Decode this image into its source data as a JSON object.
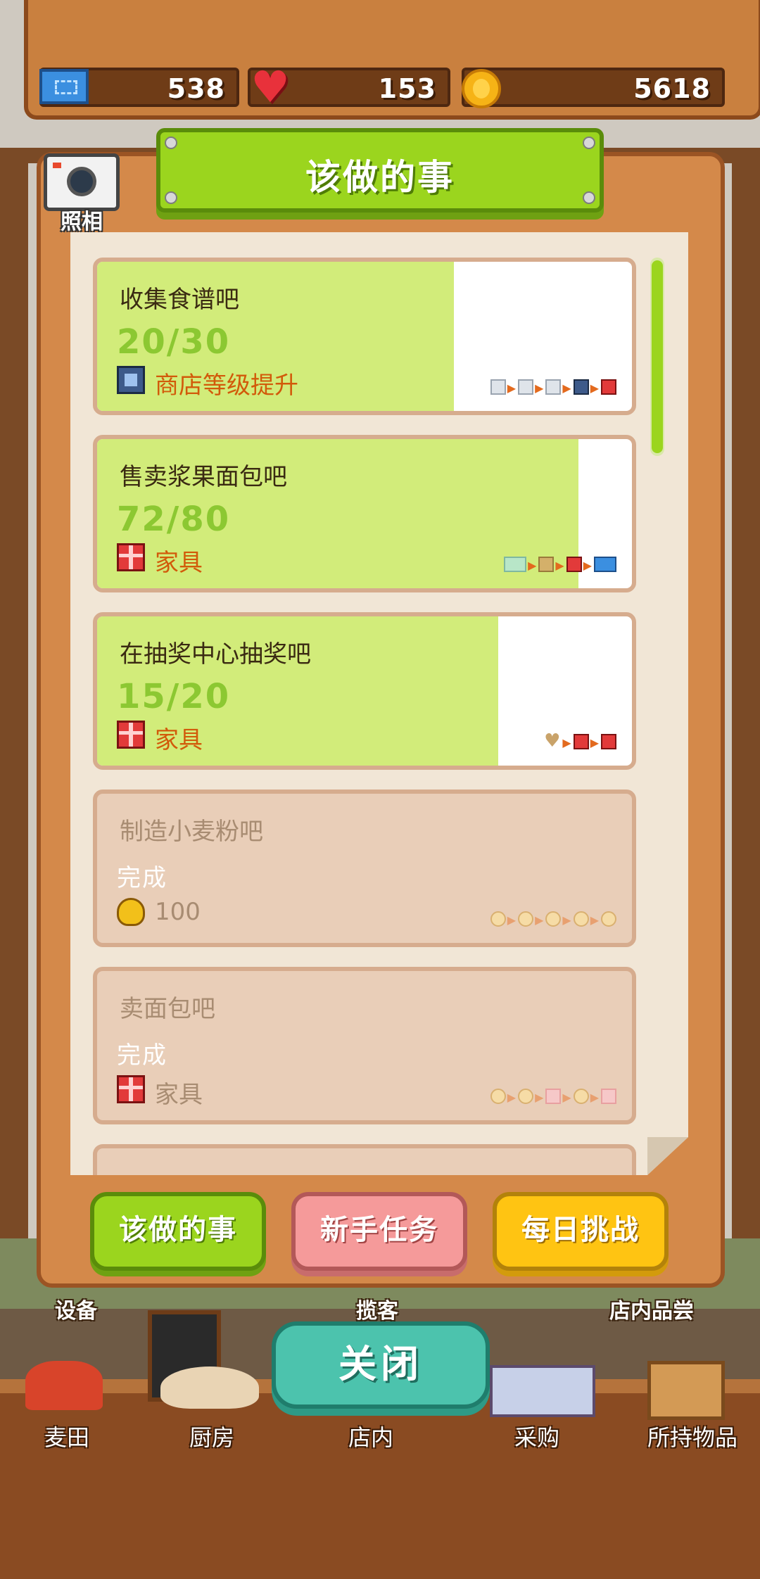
{
  "stats": {
    "tickets": "538",
    "hearts": "153",
    "coins": "5618"
  },
  "camera": {
    "label": "照相"
  },
  "panel": {
    "title": "该做的事"
  },
  "tasks": [
    {
      "name": "收集食谱吧",
      "progress": "20/30",
      "fraction": 0.667,
      "reward": "商店等级提升",
      "reward_icon": "shop-icon",
      "status": "active"
    },
    {
      "name": "售卖浆果面包吧",
      "progress": "72/80",
      "fraction": 0.9,
      "reward": "家具",
      "reward_icon": "gift-icon",
      "status": "active"
    },
    {
      "name": "在抽奖中心抽奖吧",
      "progress": "15/20",
      "fraction": 0.75,
      "reward": "家具",
      "reward_icon": "gift-icon",
      "status": "active"
    },
    {
      "name": "制造小麦粉吧",
      "progress": "完成",
      "reward": "100",
      "reward_icon": "coin-icon",
      "status": "done"
    },
    {
      "name": "卖面包吧",
      "progress": "完成",
      "reward": "家具",
      "reward_icon": "gift-icon",
      "status": "done"
    }
  ],
  "tabs": {
    "todo": "该做的事",
    "newbie": "新手任务",
    "daily": "每日挑战"
  },
  "scene_labels": {
    "equipment": "设备",
    "attract": "揽客",
    "tasting": "店内品尝"
  },
  "close_label": "关闭",
  "bottom_nav": {
    "field": "麦田",
    "kitchen": "厨房",
    "store": "店内",
    "purchase": "采购",
    "inventory": "所持物品"
  },
  "colors": {
    "accent_green": "#9bd51e",
    "progress_fill": "#d2ec7a",
    "reward_orange": "#d25a0a",
    "close_teal": "#4cc3ad",
    "newbie_pink": "#f59a9a",
    "daily_yellow": "#ffc412"
  }
}
